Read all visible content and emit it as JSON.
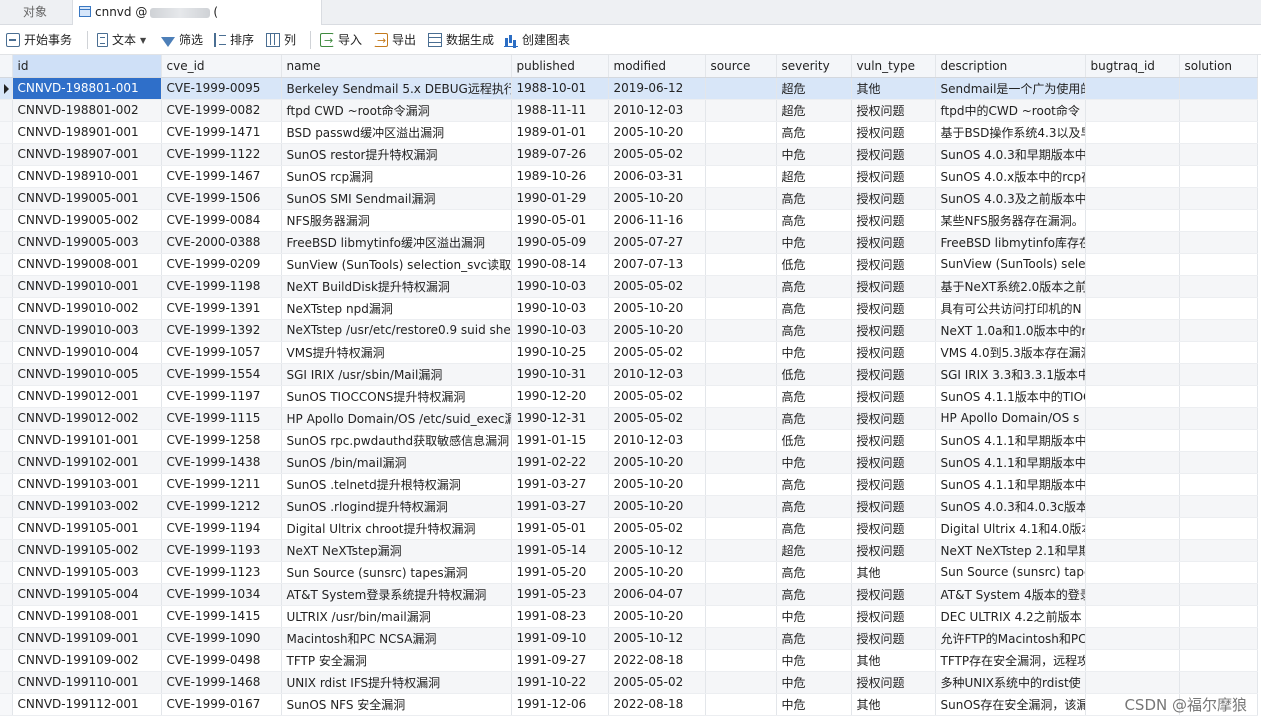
{
  "tabs": {
    "objects": "对象",
    "active_prefix": "cnnvd @",
    "active_suffix": "("
  },
  "toolbar": {
    "begin_tx": "开始事务",
    "text": "文本",
    "filter": "筛选",
    "sort": "排序",
    "columns": "列",
    "import": "导入",
    "export": "导出",
    "data_gen": "数据生成",
    "create_chart": "创建图表"
  },
  "columns": [
    "id",
    "cve_id",
    "name",
    "published",
    "modified",
    "source",
    "severity",
    "vuln_type",
    "description",
    "bugtraq_id",
    "solution"
  ],
  "rows": [
    [
      "CNNVD-198801-001",
      "CVE-1999-0095",
      "Berkeley Sendmail 5.x DEBUG远程执行",
      "1988-10-01",
      "2019-06-12",
      "",
      "超危",
      "其他",
      "Sendmail是一个广为使用的",
      "",
      ""
    ],
    [
      "CNNVD-198801-002",
      "CVE-1999-0082",
      "ftpd CWD ~root命令漏洞",
      "1988-11-11",
      "2010-12-03",
      "",
      "超危",
      "授权问题",
      "ftpd中的CWD ~root命令",
      "",
      ""
    ],
    [
      "CNNVD-198901-001",
      "CVE-1999-1471",
      "BSD passwd缓冲区溢出漏洞",
      "1989-01-01",
      "2005-10-20",
      "",
      "高危",
      "授权问题",
      "基于BSD操作系统4.3以及早",
      "",
      ""
    ],
    [
      "CNNVD-198907-001",
      "CVE-1999-1122",
      "SunOS restor提升特权漏洞",
      "1989-07-26",
      "2005-05-02",
      "",
      "中危",
      "授权问题",
      "SunOS 4.0.3和早期版本中",
      "",
      ""
    ],
    [
      "CNNVD-198910-001",
      "CVE-1999-1467",
      "SunOS rcp漏洞",
      "1989-10-26",
      "2006-03-31",
      "",
      "超危",
      "授权问题",
      "SunOS 4.0.x版本中的rcp存",
      "",
      ""
    ],
    [
      "CNNVD-199005-001",
      "CVE-1999-1506",
      "SunOS SMI Sendmail漏洞",
      "1990-01-29",
      "2005-10-20",
      "",
      "高危",
      "授权问题",
      "SunOS 4.0.3及之前版本中",
      "",
      ""
    ],
    [
      "CNNVD-199005-002",
      "CVE-1999-0084",
      "NFS服务器漏洞",
      "1990-05-01",
      "2006-11-16",
      "",
      "高危",
      "授权问题",
      "某些NFS服务器存在漏洞。",
      "",
      ""
    ],
    [
      "CNNVD-199005-003",
      "CVE-2000-0388",
      "FreeBSD libmytinfo缓冲区溢出漏洞",
      "1990-05-09",
      "2005-07-27",
      "",
      "中危",
      "授权问题",
      "FreeBSD libmytinfo库存在",
      "",
      ""
    ],
    [
      "CNNVD-199008-001",
      "CVE-1999-0209",
      "SunView (SunTools) selection_svc读取",
      "1990-08-14",
      "2007-07-13",
      "",
      "低危",
      "授权问题",
      "SunView (SunTools) sele",
      "",
      ""
    ],
    [
      "CNNVD-199010-001",
      "CVE-1999-1198",
      "NeXT BuildDisk提升特权漏洞",
      "1990-10-03",
      "2005-05-02",
      "",
      "高危",
      "授权问题",
      "基于NeXT系统2.0版本之前",
      "",
      ""
    ],
    [
      "CNNVD-199010-002",
      "CVE-1999-1391",
      "NeXTstep npd漏洞",
      "1990-10-03",
      "2005-10-20",
      "",
      "高危",
      "授权问题",
      "具有可公共访问打印机的N",
      "",
      ""
    ],
    [
      "CNNVD-199010-003",
      "CVE-1999-1392",
      "NeXTstep /usr/etc/restore0.9 suid she",
      "1990-10-03",
      "2005-10-20",
      "",
      "高危",
      "授权问题",
      "NeXT 1.0a和1.0版本中的r",
      "",
      ""
    ],
    [
      "CNNVD-199010-004",
      "CVE-1999-1057",
      "VMS提升特权漏洞",
      "1990-10-25",
      "2005-05-02",
      "",
      "中危",
      "授权问题",
      "VMS 4.0到5.3版本存在漏洞",
      "",
      ""
    ],
    [
      "CNNVD-199010-005",
      "CVE-1999-1554",
      "SGI IRIX /usr/sbin/Mail漏洞",
      "1990-10-31",
      "2010-12-03",
      "",
      "低危",
      "授权问题",
      "SGI IRIX 3.3和3.3.1版本中",
      "",
      ""
    ],
    [
      "CNNVD-199012-001",
      "CVE-1999-1197",
      "SunOS TIOCCONS提升特权漏洞",
      "1990-12-20",
      "2005-05-02",
      "",
      "高危",
      "授权问题",
      "SunOS 4.1.1版本中的TIOC",
      "",
      ""
    ],
    [
      "CNNVD-199012-002",
      "CVE-1999-1115",
      "HP Apollo Domain/OS /etc/suid_exec漏",
      "1990-12-31",
      "2005-05-02",
      "",
      "高危",
      "授权问题",
      "HP Apollo Domain/OS s",
      "",
      ""
    ],
    [
      "CNNVD-199101-001",
      "CVE-1999-1258",
      "SunOS rpc.pwdauthd获取敏感信息漏洞",
      "1991-01-15",
      "2010-12-03",
      "",
      "低危",
      "授权问题",
      "SunOS 4.1.1和早期版本中",
      "",
      ""
    ],
    [
      "CNNVD-199102-001",
      "CVE-1999-1438",
      "SunOS /bin/mail漏洞",
      "1991-02-22",
      "2005-10-20",
      "",
      "中危",
      "授权问题",
      "SunOS 4.1.1和早期版本中",
      "",
      ""
    ],
    [
      "CNNVD-199103-001",
      "CVE-1999-1211",
      "SunOS .telnetd提升根特权漏洞",
      "1991-03-27",
      "2005-10-20",
      "",
      "高危",
      "授权问题",
      "SunOS 4.1.1和早期版本中",
      "",
      ""
    ],
    [
      "CNNVD-199103-002",
      "CVE-1999-1212",
      "SunOS .rlogind提升特权漏洞",
      "1991-03-27",
      "2005-10-20",
      "",
      "高危",
      "授权问题",
      "SunOS 4.0.3和4.0.3c版本中",
      "",
      ""
    ],
    [
      "CNNVD-199105-001",
      "CVE-1999-1194",
      "Digital Ultrix chroot提升特权漏洞",
      "1991-05-01",
      "2005-05-02",
      "",
      "高危",
      "授权问题",
      "Digital Ultrix 4.1和4.0版本",
      "",
      ""
    ],
    [
      "CNNVD-199105-002",
      "CVE-1999-1193",
      "NeXT NeXTstep漏洞",
      "1991-05-14",
      "2005-10-12",
      "",
      "超危",
      "授权问题",
      "NeXT NeXTstep 2.1和早期",
      "",
      ""
    ],
    [
      "CNNVD-199105-003",
      "CVE-1999-1123",
      "Sun Source (sunsrc) tapes漏洞",
      "1991-05-20",
      "2005-10-20",
      "",
      "高危",
      "其他",
      "Sun Source (sunsrc) tape",
      "",
      ""
    ],
    [
      "CNNVD-199105-004",
      "CVE-1999-1034",
      "AT&T System登录系统提升特权漏洞",
      "1991-05-23",
      "2006-04-07",
      "",
      "高危",
      "授权问题",
      "AT&T System 4版本的登录",
      "",
      ""
    ],
    [
      "CNNVD-199108-001",
      "CVE-1999-1415",
      "ULTRIX /usr/bin/mail漏洞",
      "1991-08-23",
      "2005-10-20",
      "",
      "中危",
      "授权问题",
      "DEC ULTRIX 4.2之前版本",
      "",
      ""
    ],
    [
      "CNNVD-199109-001",
      "CVE-1999-1090",
      "Macintosh和PC NCSA漏洞",
      "1991-09-10",
      "2005-10-12",
      "",
      "高危",
      "授权问题",
      "允许FTP的Macintosh和PC",
      "",
      ""
    ],
    [
      "CNNVD-199109-002",
      "CVE-1999-0498",
      "TFTP 安全漏洞",
      "1991-09-27",
      "2022-08-18",
      "",
      "中危",
      "其他",
      "TFTP存在安全漏洞，远程攻",
      "",
      ""
    ],
    [
      "CNNVD-199110-001",
      "CVE-1999-1468",
      "UNIX rdist IFS提升特权漏洞",
      "1991-10-22",
      "2005-05-02",
      "",
      "中危",
      "授权问题",
      "多种UNIX系统中的rdist使",
      "",
      ""
    ],
    [
      "CNNVD-199112-001",
      "CVE-1999-0167",
      "SunOS NFS 安全漏洞",
      "1991-12-06",
      "2022-08-18",
      "",
      "中危",
      "其他",
      "SunOS存在安全漏洞，该漏",
      "",
      ""
    ]
  ],
  "watermark": "CSDN @福尔摩狼"
}
